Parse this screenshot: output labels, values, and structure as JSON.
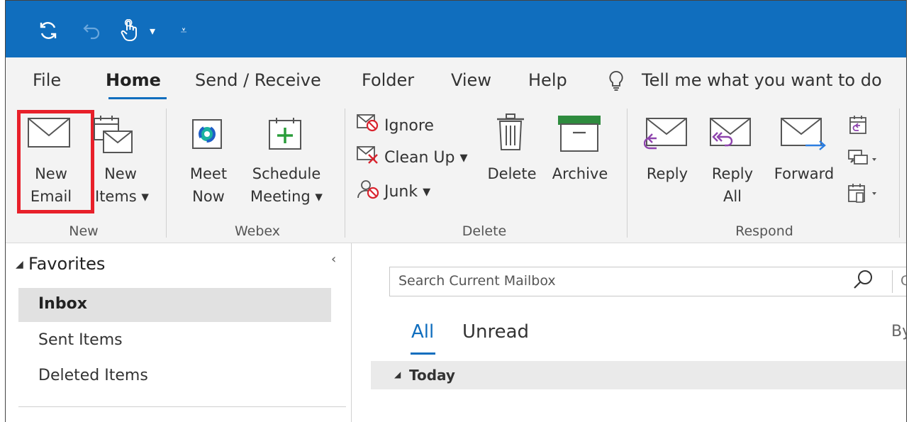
{
  "quick_access": {
    "sync_icon": "sync-icon",
    "undo_icon": "undo-icon",
    "touch_icon": "touch-mode-icon",
    "dropdown_glyph": "▾",
    "customize_glyph": "⩡"
  },
  "menu": {
    "tabs": [
      "File",
      "Home",
      "Send / Receive",
      "Folder",
      "View",
      "Help"
    ],
    "active": "Home",
    "tell_me": "Tell me what you want to do"
  },
  "ribbon": {
    "new_group": {
      "label": "New",
      "new_email_line1": "New",
      "new_email_line2": "Email",
      "new_items_line1": "New",
      "new_items_line2": "Items ▾"
    },
    "webex_group": {
      "label": "Webex",
      "meet_line1": "Meet",
      "meet_line2": "Now",
      "schedule_line1": "Schedule",
      "schedule_line2": "Meeting ▾"
    },
    "delete_group": {
      "label": "Delete",
      "ignore": "Ignore",
      "clean_up": "Clean Up ▾",
      "junk": "Junk ▾",
      "delete": "Delete",
      "archive": "Archive"
    },
    "respond_group": {
      "label": "Respond",
      "reply": "Reply",
      "reply_all_line1": "Reply",
      "reply_all_line2": "All",
      "forward": "Forward"
    }
  },
  "folders": {
    "favorites_label": "Favorites",
    "items": [
      "Inbox",
      "Sent Items",
      "Deleted Items"
    ],
    "selected": "Inbox"
  },
  "mail_list": {
    "search_placeholder": "Search Current Mailbox",
    "search_trunc": "C",
    "filters": [
      "All",
      "Unread"
    ],
    "active_filter": "All",
    "sort_trunc": "By",
    "group_header": "Today"
  },
  "colors": {
    "title_blue": "#106ebe",
    "highlight_red": "#e8202a",
    "ribbon_bg": "#f3f3f3"
  }
}
